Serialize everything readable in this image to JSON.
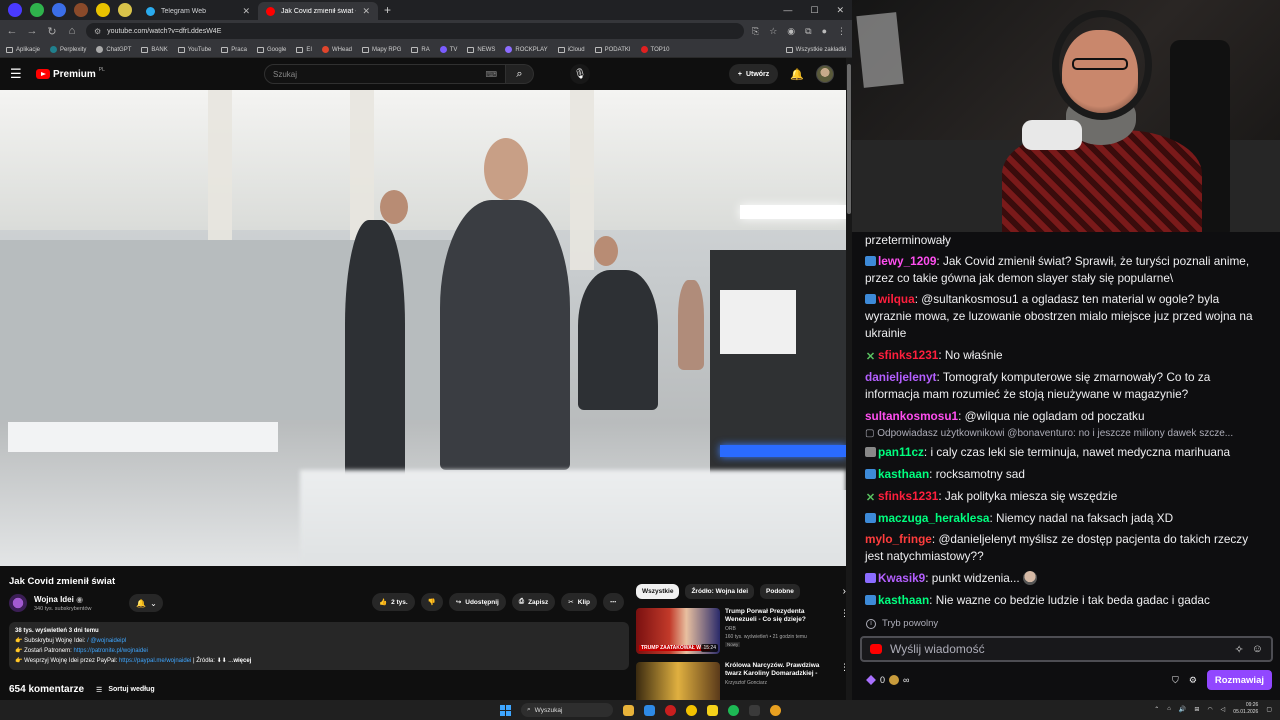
{
  "browser": {
    "tabs": [
      {
        "label": "Telegram Web",
        "active": false,
        "color": "#2aabee"
      },
      {
        "label": "Jak Covid zmienił świat - YouTub",
        "active": true,
        "color": "#ff0000"
      }
    ],
    "url": "youtube.com/watch?v=dfrLddesW4E",
    "bookmarks": [
      "Aplikacje",
      "Perplexity",
      "ChatGPT",
      "BANK",
      "YouTube",
      "Praca",
      "Google",
      "EI",
      "WHead",
      "Mapy RPG",
      "RA",
      "TV",
      "NEWS",
      "ROCKPLAY",
      "iCloud",
      "PODATKI",
      "TOP10"
    ],
    "bookmarks_all": "Wszystkie zakładki"
  },
  "youtube": {
    "logo": "Premium",
    "logo_cc": "PL",
    "search_placeholder": "Szukaj",
    "create_label": "Utwórz",
    "video_title": "Jak Covid zmienił świat",
    "channel_name": "Wojna Idei",
    "channel_subs": "340 tys. subskrybentów",
    "likes": "2 tys.",
    "actions": {
      "share": "Udostępnij",
      "save": "Zapisz",
      "clip": "Klip"
    },
    "description": {
      "stats": "38 tys. wyświetleń  3 dni temu",
      "line1_prefix": "👉 Subskrybuj Wojnę Idei:",
      "line1_link": "/ @wojnaideipl",
      "line2_prefix": "👉 Zostań Patronem:",
      "line2_link": "https://patronite.pl/wojnaidei",
      "line3_prefix": "👉 Wesprzyj Wojnę Idei przez PayPal:",
      "line3_link": "https://paypal.me/wojnaidei",
      "line3_sources": "|   Źródła: ⬇⬇ ...",
      "more": "więcej"
    },
    "comments_count": "654 komentarze",
    "sort_label": "Sortuj według",
    "chips": [
      "Wszystkie",
      "Źródło: Wojna Idei",
      "Podobne"
    ],
    "recommendations": [
      {
        "title": "Trump Porwał Prezydenta Wenezueli - Co się dzieje?",
        "channel": "ORB",
        "meta": "160 tys. wyświetleń • 21 godzin temu",
        "badge": "Nowy",
        "duration": "15:24",
        "caption": "TRUMP ZAATAKOWAŁ WEN"
      },
      {
        "title": "Królowa Narcyzów. Prawdziwa twarz Karoliny Domaradzkiej -",
        "channel": "Krzysztof Gonciarz",
        "meta": "",
        "badge": "",
        "duration": "",
        "caption": ""
      }
    ]
  },
  "chat": {
    "first_line": "przeterminowały",
    "messages": [
      {
        "user": "lewy_1209",
        "color": "#ff4ff0",
        "badge": "tv",
        "text": "Jak Covid zmienił świat? Sprawił, że turyści poznali anime, przez co takie gówna jak demon slayer stały się popularne\\"
      },
      {
        "user": "wilqua",
        "color": "#ff1f3d",
        "badge": "tv",
        "text": "@sultankosmosu1 a ogladasz ten material w ogole? byla wyraznie mowa, ze luzowanie obostrzen mialo miejsce juz przed wojna na ukrainie"
      },
      {
        "user": "sfinks1231",
        "color": "#ff1f3d",
        "badge": "x",
        "text": "No właśnie"
      },
      {
        "user": "danieljelenyt",
        "color": "#b45fff",
        "badge": "",
        "text": "Tomografy komputerowe się zmarnowały? Co to za informacja mam rozumieć że stoją nieużywane w magazynie?"
      },
      {
        "user": "sultankosmosu1",
        "color": "#ff4ff0",
        "badge": "",
        "text": "@wilqua nie ogladam od poczatku"
      },
      {
        "user": "pan11cz",
        "color": "#00ff7f",
        "badge": "tv",
        "text": "i caly czas leki sie terminuja, nawet medyczna marihuana"
      },
      {
        "user": "kasthaan",
        "color": "#00ff7f",
        "badge": "tv",
        "text": "rocksamotny sad"
      },
      {
        "user": "sfinks1231",
        "color": "#ff1f3d",
        "badge": "x",
        "text": "Jak polityka miesza się wszędzie"
      },
      {
        "user": "maczuga_heraklesa",
        "color": "#00ff7f",
        "badge": "tv",
        "text": "Niemcy nadal na faksach jadą XD"
      },
      {
        "user": "mylo_fringe",
        "color": "#ff3d3d",
        "badge": "",
        "text": "@danieljelenyt myślisz ze dostęp pacjenta do takich rzeczy jest natychmiastowy??"
      },
      {
        "user": "Kwasik9",
        "color": "#b45fff",
        "badge": "star",
        "text": "punkt widzenia..."
      },
      {
        "user": "kasthaan",
        "color": "#00ff7f",
        "badge": "tv",
        "text": "Nie wazne co bedzie ludzie i tak beda gadac i gadac"
      }
    ],
    "reply_notice": "Odpowiadasz użytkownikowi @bonaventuro: no i jeszcze miliony dawek szcze...",
    "slow_mode": "Tryb powolny",
    "input_placeholder": "Wyślij wiadomość",
    "points": "0",
    "points_suffix": "∞",
    "chat_button": "Rozmawiaj"
  },
  "taskbar": {
    "search": "Wyszukaj",
    "time": "09:26",
    "date": "05.01.2026"
  }
}
